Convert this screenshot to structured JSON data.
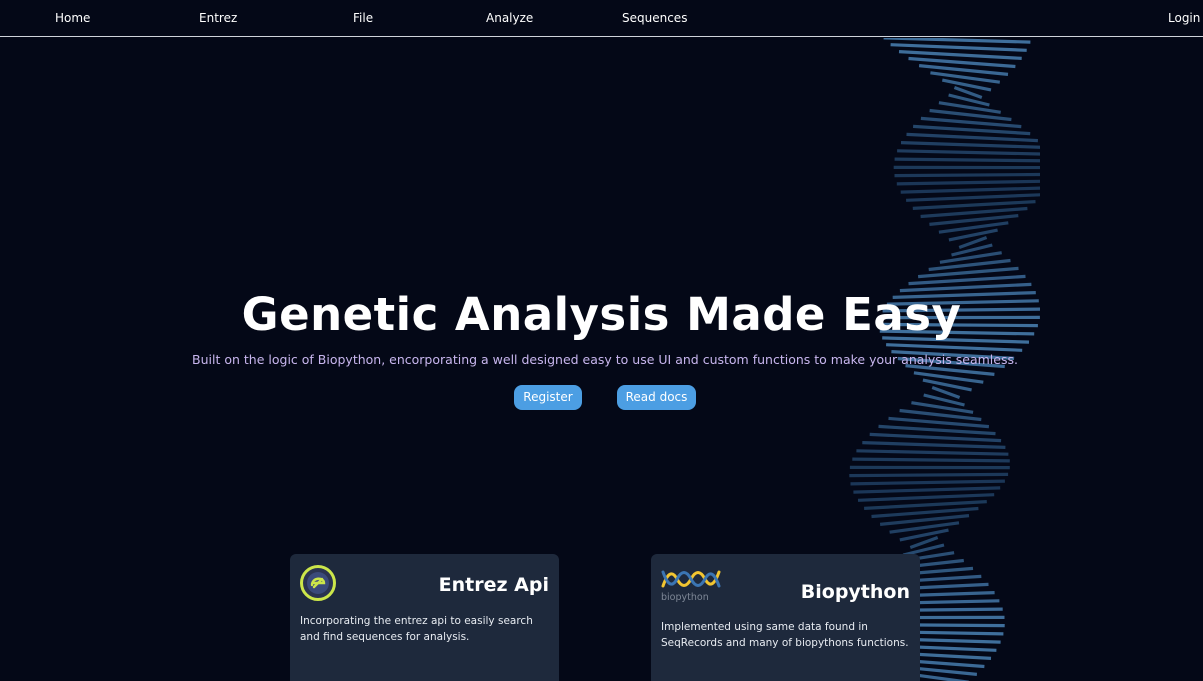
{
  "nav": {
    "items": [
      {
        "label": "Home"
      },
      {
        "label": "Entrez"
      },
      {
        "label": "File"
      },
      {
        "label": "Analyze"
      },
      {
        "label": "Sequences"
      }
    ],
    "login": "Login"
  },
  "hero": {
    "title": "Genetic Analysis Made Easy",
    "subtitle": "Built on the logic of Biopython, encorporating a well designed easy to use UI and custom functions to make your analysis seamless.",
    "buttons": {
      "register": "Register",
      "docs": "Read docs"
    }
  },
  "cards": [
    {
      "title": "Entrez Api",
      "icon": "entrez-logo-icon",
      "description": "Incorporating the entrez api to easily search and find sequences for analysis."
    },
    {
      "title": "Biopython",
      "icon": "biopython-logo-icon",
      "logo_text": "biopython",
      "description": "Implemented using same data found in SeqRecords and many of biopythons functions."
    }
  ],
  "colors": {
    "background": "#040817",
    "accent": "#4c9ee3",
    "subtitle": "#c8b6ee",
    "card": "#1e293c",
    "entrez_ring": "#cce64a",
    "biopython_yellow": "#f2c531",
    "biopython_blue": "#3b75b3"
  }
}
